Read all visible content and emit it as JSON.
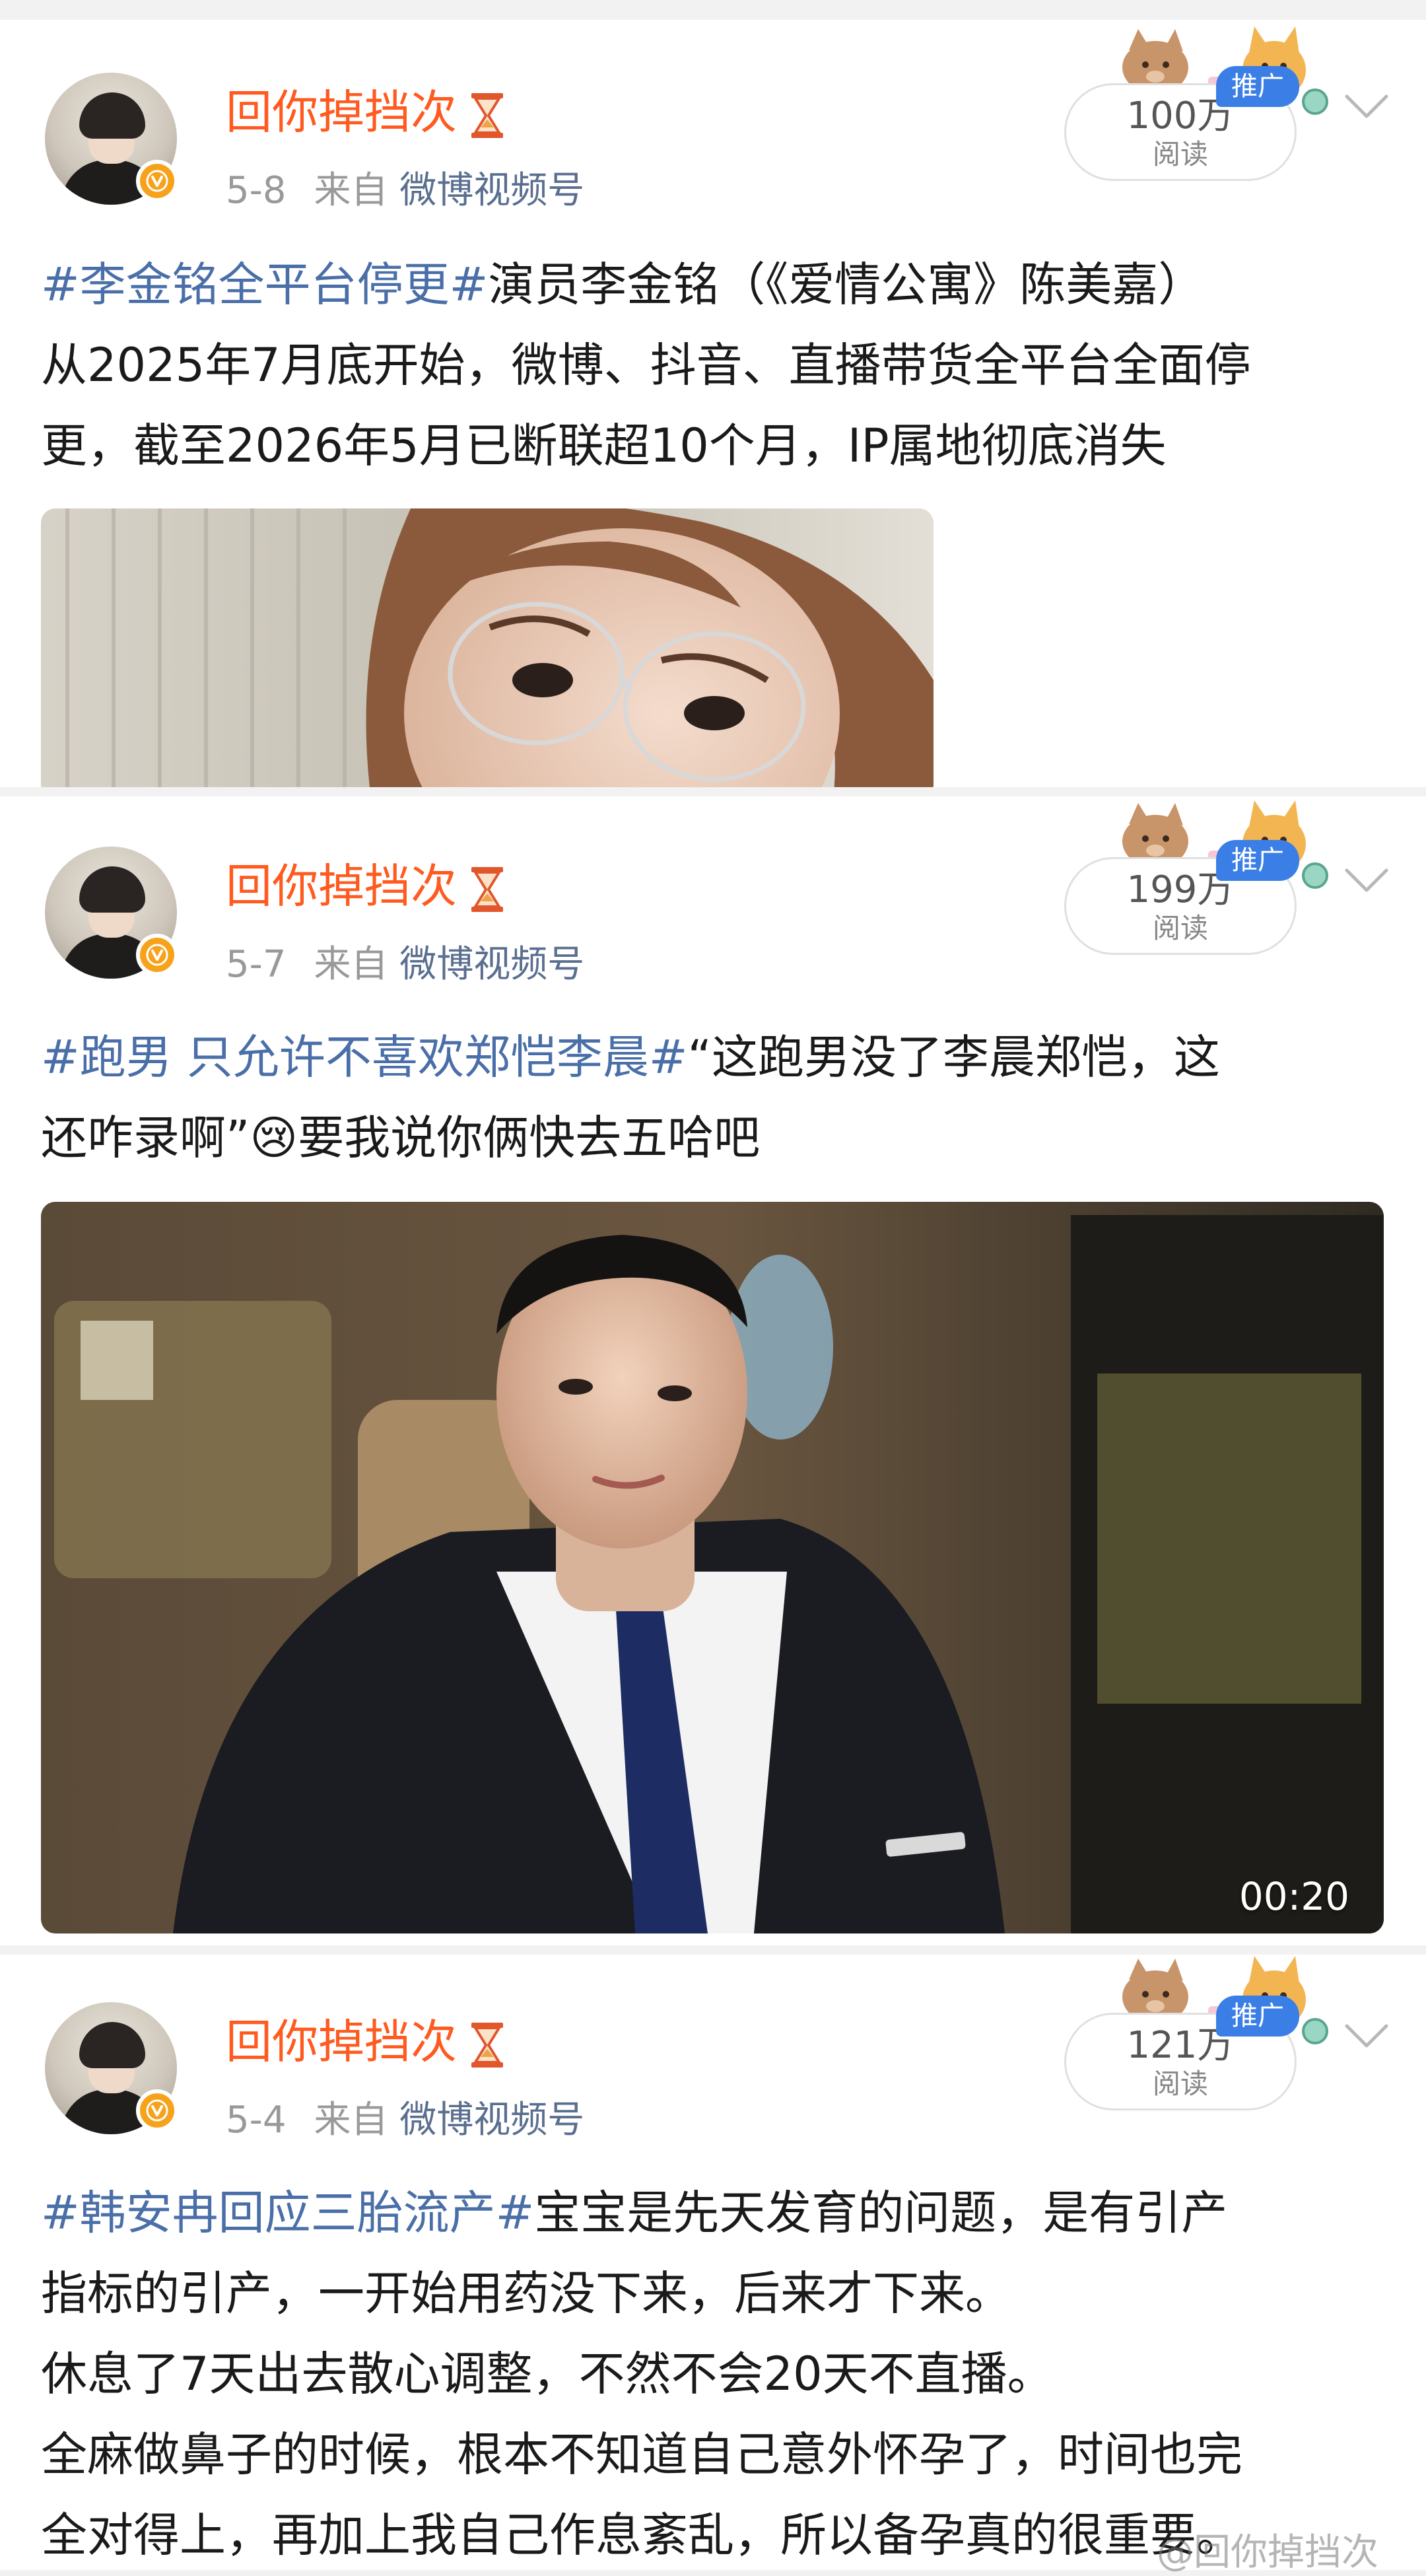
{
  "posts": [
    {
      "username": "回你掉挡次",
      "date": "5-8",
      "from_label": "来自",
      "source": "微博视频号",
      "reads_count": "100万",
      "reads_label": "阅读",
      "promo_label": "推广",
      "text_lines": [
        {
          "topic": "#李金铭全平台停更#",
          "text": "演员李金铭（《爱情公寓》陈美嘉）"
        },
        {
          "topic": "",
          "text": "从2025年7月底开始，微博、抖音、直播带货全平台全面停"
        },
        {
          "topic": "",
          "text": "更，截至2026年5月已断联超10个月，IP属地彻底消失"
        }
      ]
    },
    {
      "username": "回你掉挡次",
      "date": "5-7",
      "from_label": "来自",
      "source": "微博视频号",
      "reads_count": "199万",
      "reads_label": "阅读",
      "promo_label": "推广",
      "text_lines": [
        {
          "topic": "#跑男 只允许不喜欢郑恺李晨#",
          "text": "“这跑男没了李晨郑恺，这"
        },
        {
          "topic": "",
          "text": "还咋录啊”😢要我说你俩快去五哈吧"
        }
      ],
      "video_duration": "00:20"
    },
    {
      "username": "回你掉挡次",
      "date": "5-4",
      "from_label": "来自",
      "source": "微博视频号",
      "reads_count": "121万",
      "reads_label": "阅读",
      "promo_label": "推广",
      "text_lines": [
        {
          "topic": "#韩安冉回应三胎流产#",
          "text": "宝宝是先天发育的问题，是有引产"
        },
        {
          "topic": "",
          "text": "指标的引产，一开始用药没下来，后来才下来。"
        },
        {
          "topic": "",
          "text": "休息了7天出去散心调整，不然不会20天不直播。"
        },
        {
          "topic": "",
          "text": "全麻做鼻子的时候，根本不知道自己意外怀孕了，时间也完"
        },
        {
          "topic": "",
          "text": "全对得上，再加上我自己作息紊乱，所以备孕真的很重要。"
        }
      ]
    }
  ],
  "watermark": "@回你掉挡次",
  "colors": {
    "username": "#ff5a1f",
    "topic": "#4a6fa8",
    "meta": "#999999",
    "promo": "#3b7fe6",
    "verified_badge": "#f7a21b"
  },
  "icons": [
    "hourglass-icon",
    "verified-badge-icon",
    "chevron-down-icon",
    "cartoon-animals-decoration"
  ]
}
